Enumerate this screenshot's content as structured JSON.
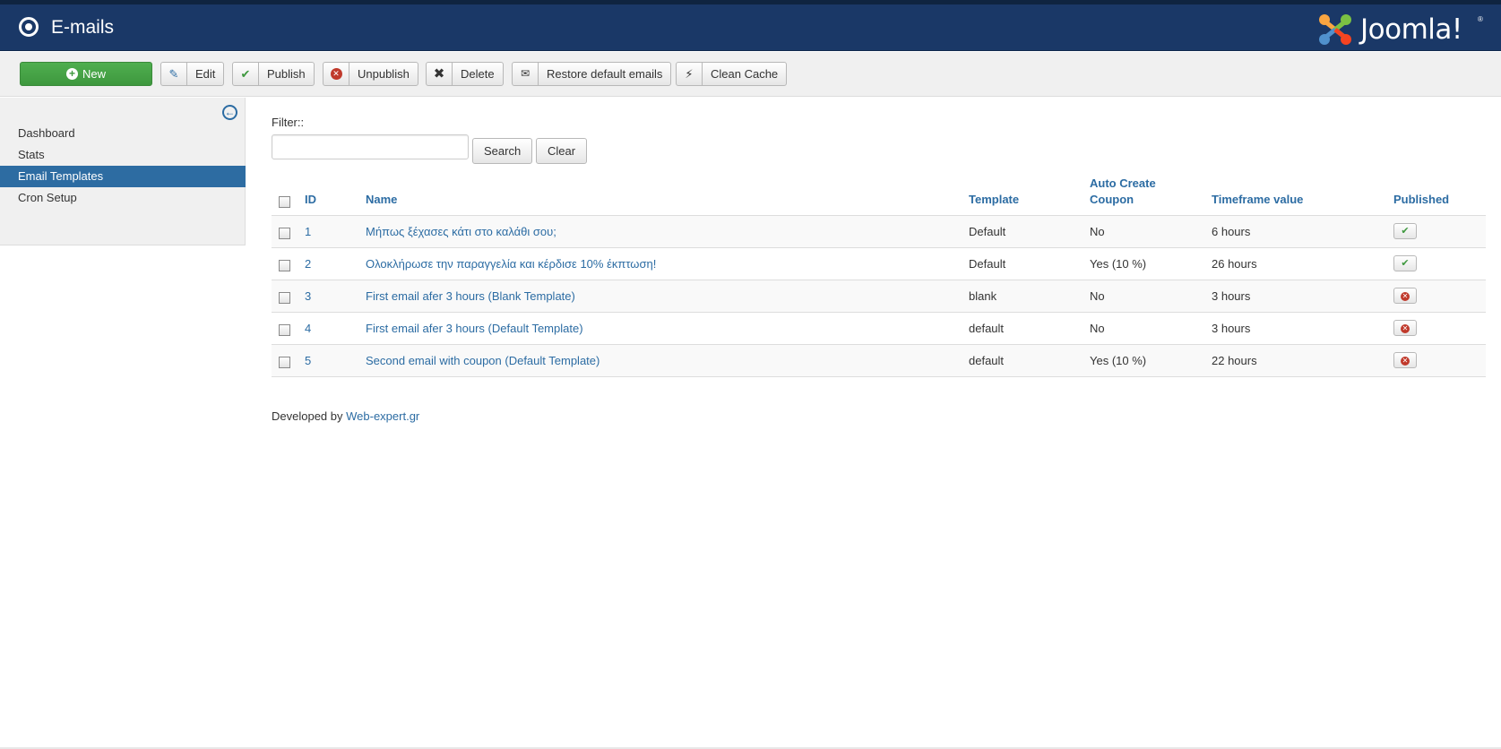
{
  "header": {
    "title": "E-mails",
    "logo_text": "Joomla!",
    "logo_reg": "®"
  },
  "toolbar": {
    "new_label": "New",
    "edit_label": "Edit",
    "publish_label": "Publish",
    "unpublish_label": "Unpublish",
    "delete_label": "Delete",
    "restore_label": "Restore default emails",
    "clean_cache_label": "Clean Cache"
  },
  "sidebar": {
    "items": [
      {
        "label": "Dashboard"
      },
      {
        "label": "Stats"
      },
      {
        "label": "Email Templates"
      },
      {
        "label": "Cron Setup"
      }
    ]
  },
  "filter": {
    "label": "Filter::",
    "value": "",
    "search_label": "Search",
    "clear_label": "Clear"
  },
  "table": {
    "headers": {
      "id": "ID",
      "name": "Name",
      "template": "Template",
      "auto_create_line1": "Auto Create",
      "auto_create_line2": "Coupon",
      "timeframe": "Timeframe value",
      "published": "Published"
    },
    "rows": [
      {
        "id": "1",
        "name": "Μήπως ξέχασες κάτι στο καλάθι σου;",
        "template": "Default",
        "coupon": "No",
        "timeframe": "6 hours",
        "published": true
      },
      {
        "id": "2",
        "name": "Ολοκλήρωσε την παραγγελία και κέρδισε 10% έκπτωση!",
        "template": "Default",
        "coupon": "Yes (10 %)",
        "timeframe": "26 hours",
        "published": true
      },
      {
        "id": "3",
        "name": "First email afer 3 hours (Blank Template)",
        "template": "blank",
        "coupon": "No",
        "timeframe": "3 hours",
        "published": false
      },
      {
        "id": "4",
        "name": "First email afer 3 hours (Default Template)",
        "template": "default",
        "coupon": "No",
        "timeframe": "3 hours",
        "published": false
      },
      {
        "id": "5",
        "name": "Second email with coupon (Default Template)",
        "template": "default",
        "coupon": "Yes (10 %)",
        "timeframe": "22 hours",
        "published": false
      }
    ]
  },
  "footer": {
    "prefix": "Developed by",
    "link_text": "Web-expert.gr"
  },
  "colors": {
    "header_bg": "#1a3867",
    "accent": "#2c6ca3",
    "new_button": "#3e983e",
    "unpublished": "#c0392b"
  }
}
